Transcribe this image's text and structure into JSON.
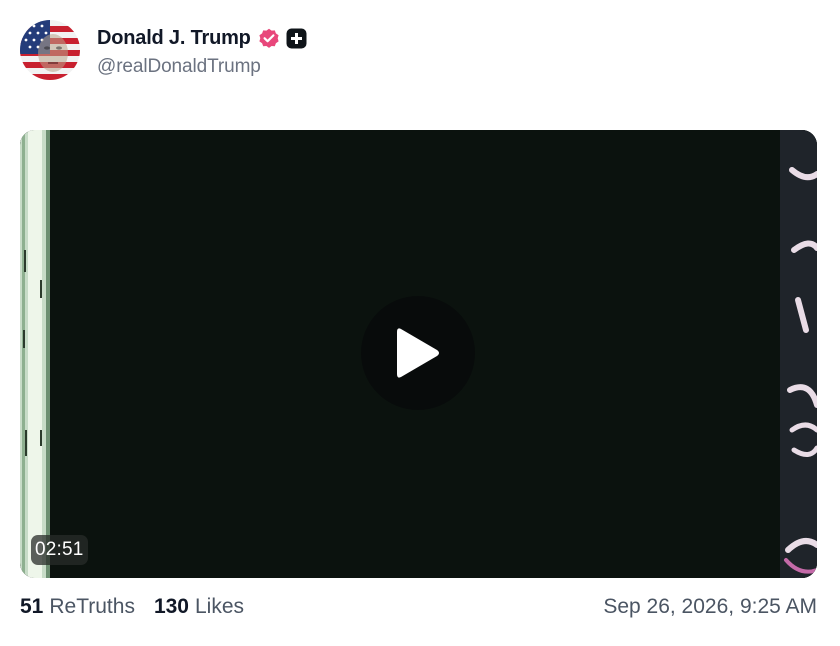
{
  "post": {
    "author": {
      "display_name": "Donald J. Trump",
      "handle": "@realDonaldTrump",
      "avatar": "flag-face-avatar",
      "verified_icon": "verified-badge-icon",
      "plus_icon": "plus-badge-icon",
      "verified_color": "#e8477b"
    },
    "media": {
      "type": "video",
      "duration": "02:51",
      "play_icon": "play-icon"
    },
    "stats": {
      "retruths_count": "51",
      "retruths_label": "ReTruths",
      "likes_count": "130",
      "likes_label": "Likes"
    },
    "timestamp": "Sep 26, 2026, 9:25 AM"
  }
}
